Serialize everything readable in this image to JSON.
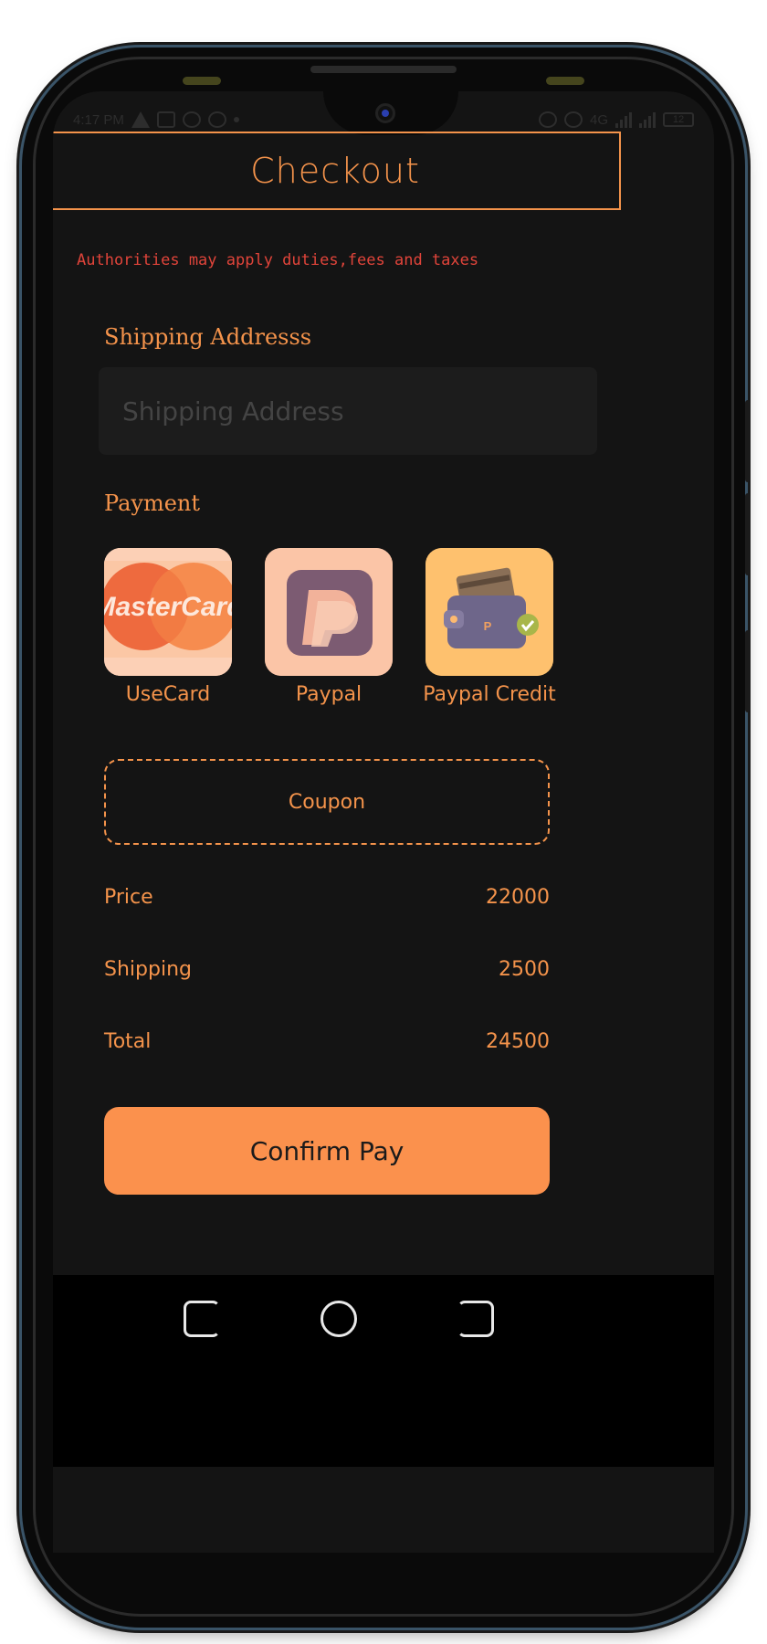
{
  "status_bar": {
    "time": "4:17 PM",
    "network": "4G",
    "battery": "12"
  },
  "header": {
    "title": "Checkout"
  },
  "notice": "Authorities may apply duties,fees and taxes",
  "shipping": {
    "label": "Shipping Addresss",
    "placeholder": "Shipping Address",
    "value": ""
  },
  "payment": {
    "label": "Payment",
    "methods": [
      {
        "label": "UseCard",
        "logo_text": "MasterCard",
        "icon": "mastercard-logo"
      },
      {
        "label": "Paypal",
        "icon": "paypal-logo"
      },
      {
        "label": "Paypal Credit",
        "icon": "wallet-card-icon"
      }
    ]
  },
  "coupon": {
    "label": "Coupon"
  },
  "summary": {
    "price_label": "Price",
    "price_value": "22000",
    "shipping_label": "Shipping",
    "shipping_value": "2500",
    "total_label": "Total",
    "total_value": "24500"
  },
  "confirm_button": {
    "label": "Confirm Pay"
  },
  "colors": {
    "accent": "#f4934b",
    "button": "#fb914d",
    "background": "#141414",
    "notice": "#e0443a"
  }
}
